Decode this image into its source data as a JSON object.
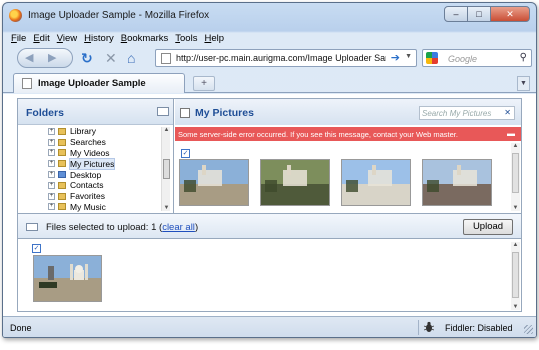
{
  "window": {
    "title": "Image Uploader Sample - Mozilla Firefox",
    "buttons": {
      "minimize": "–",
      "maximize": "□",
      "close": "✕"
    }
  },
  "menubar": {
    "items": [
      {
        "label": "File",
        "accel": "F",
        "rest": "ile"
      },
      {
        "label": "Edit",
        "accel": "E",
        "rest": "dit"
      },
      {
        "label": "View",
        "accel": "V",
        "rest": "iew"
      },
      {
        "label": "History",
        "accel": "H",
        "rest": "istory"
      },
      {
        "label": "Bookmarks",
        "accel": "B",
        "rest": "ookmarks"
      },
      {
        "label": "Tools",
        "accel": "T",
        "rest": "ools"
      },
      {
        "label": "Help",
        "accel": "H",
        "rest": "elp"
      }
    ]
  },
  "navbar": {
    "url": "http://user-pc.main.aurigma.com/Image Uploader Sample",
    "search_placeholder": "Google"
  },
  "tabs": {
    "active_label": "Image Uploader Sample",
    "new_tab": "+"
  },
  "folders": {
    "title": "Folders",
    "items": [
      {
        "label": "Library",
        "icon": "folder",
        "selected": false
      },
      {
        "label": "Searches",
        "icon": "folder",
        "selected": false
      },
      {
        "label": "My Videos",
        "icon": "folder",
        "selected": false
      },
      {
        "label": "My Pictures",
        "icon": "folder",
        "selected": true
      },
      {
        "label": "Desktop",
        "icon": "desktop",
        "selected": false
      },
      {
        "label": "Contacts",
        "icon": "folder",
        "selected": false
      },
      {
        "label": "Favorites",
        "icon": "folder",
        "selected": false
      },
      {
        "label": "My Music",
        "icon": "folder",
        "selected": false
      }
    ]
  },
  "pictures": {
    "title": "My Pictures",
    "search_placeholder": "Search My Pictures",
    "error": "Some server-side error occurred. If you see this message, contact your Web master.",
    "check_mark": "✓",
    "thumbnails": [
      {
        "name": "thumb-1",
        "checked": true,
        "colors": [
          "#8bb0d8",
          "#a89c84"
        ]
      },
      {
        "name": "thumb-2",
        "checked": false,
        "colors": [
          "#7d8e5c",
          "#4f5a3a"
        ]
      },
      {
        "name": "thumb-3",
        "checked": false,
        "colors": [
          "#9cc0e8",
          "#d8d4c8"
        ]
      },
      {
        "name": "thumb-4",
        "checked": false,
        "colors": [
          "#a9c2de",
          "#7a6a60"
        ]
      }
    ]
  },
  "upload": {
    "files_selected_prefix": "Files selected to upload: 1 (",
    "clear_all": "clear all",
    "files_selected_suffix": ")",
    "upload_button": "Upload",
    "check_mark": "✓"
  },
  "statusbar": {
    "status": "Done",
    "fiddler": "Fiddler: Disabled"
  }
}
